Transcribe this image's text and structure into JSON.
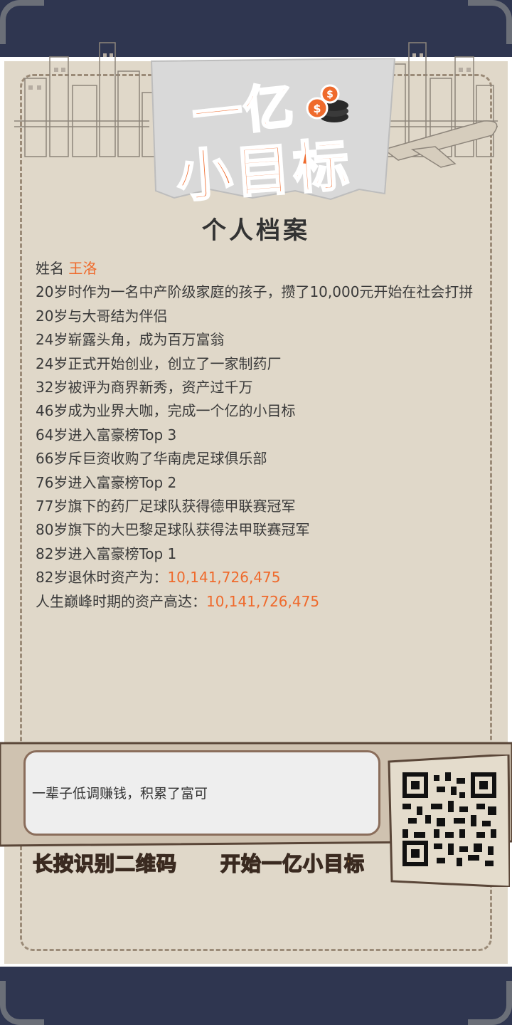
{
  "logo": {
    "line1": "一亿",
    "line2": "小目标"
  },
  "page_title": "个人档案",
  "name": {
    "label": "姓名",
    "value": "王洛"
  },
  "events": [
    "20岁时作为一名中产阶级家庭的孩子，攒了10,000元开始在社会打拼",
    "20岁与大哥结为伴侣",
    "24岁崭露头角，成为百万富翁",
    "24岁正式开始创业，创立了一家制药厂",
    "32岁被评为商界新秀，资产过千万",
    "46岁成为业界大咖，完成一个亿的小目标",
    "64岁进入富豪榜Top 3",
    "66岁斥巨资收购了华南虎足球俱乐部",
    "76岁进入富豪榜Top 2",
    "77岁旗下的药厂足球队获得德甲联赛冠军",
    "80岁旗下的大巴黎足球队获得法甲联赛冠军",
    "82岁进入富豪榜Top 1"
  ],
  "retire": {
    "label": "82岁退休时资产为：",
    "value": "10,141,726,475"
  },
  "peak": {
    "label": "人生巅峰时期的资产高达：",
    "value": "10,141,726,475"
  },
  "quote": "一辈子低调赚钱，积累了富可",
  "cta_left": "长按识别二维码",
  "cta_right": "开始一亿小目标",
  "colors": {
    "accent": "#ef6a2c",
    "cta": "#f1a83a",
    "paper": "#e0d8c9",
    "frame": "#2f3650"
  }
}
